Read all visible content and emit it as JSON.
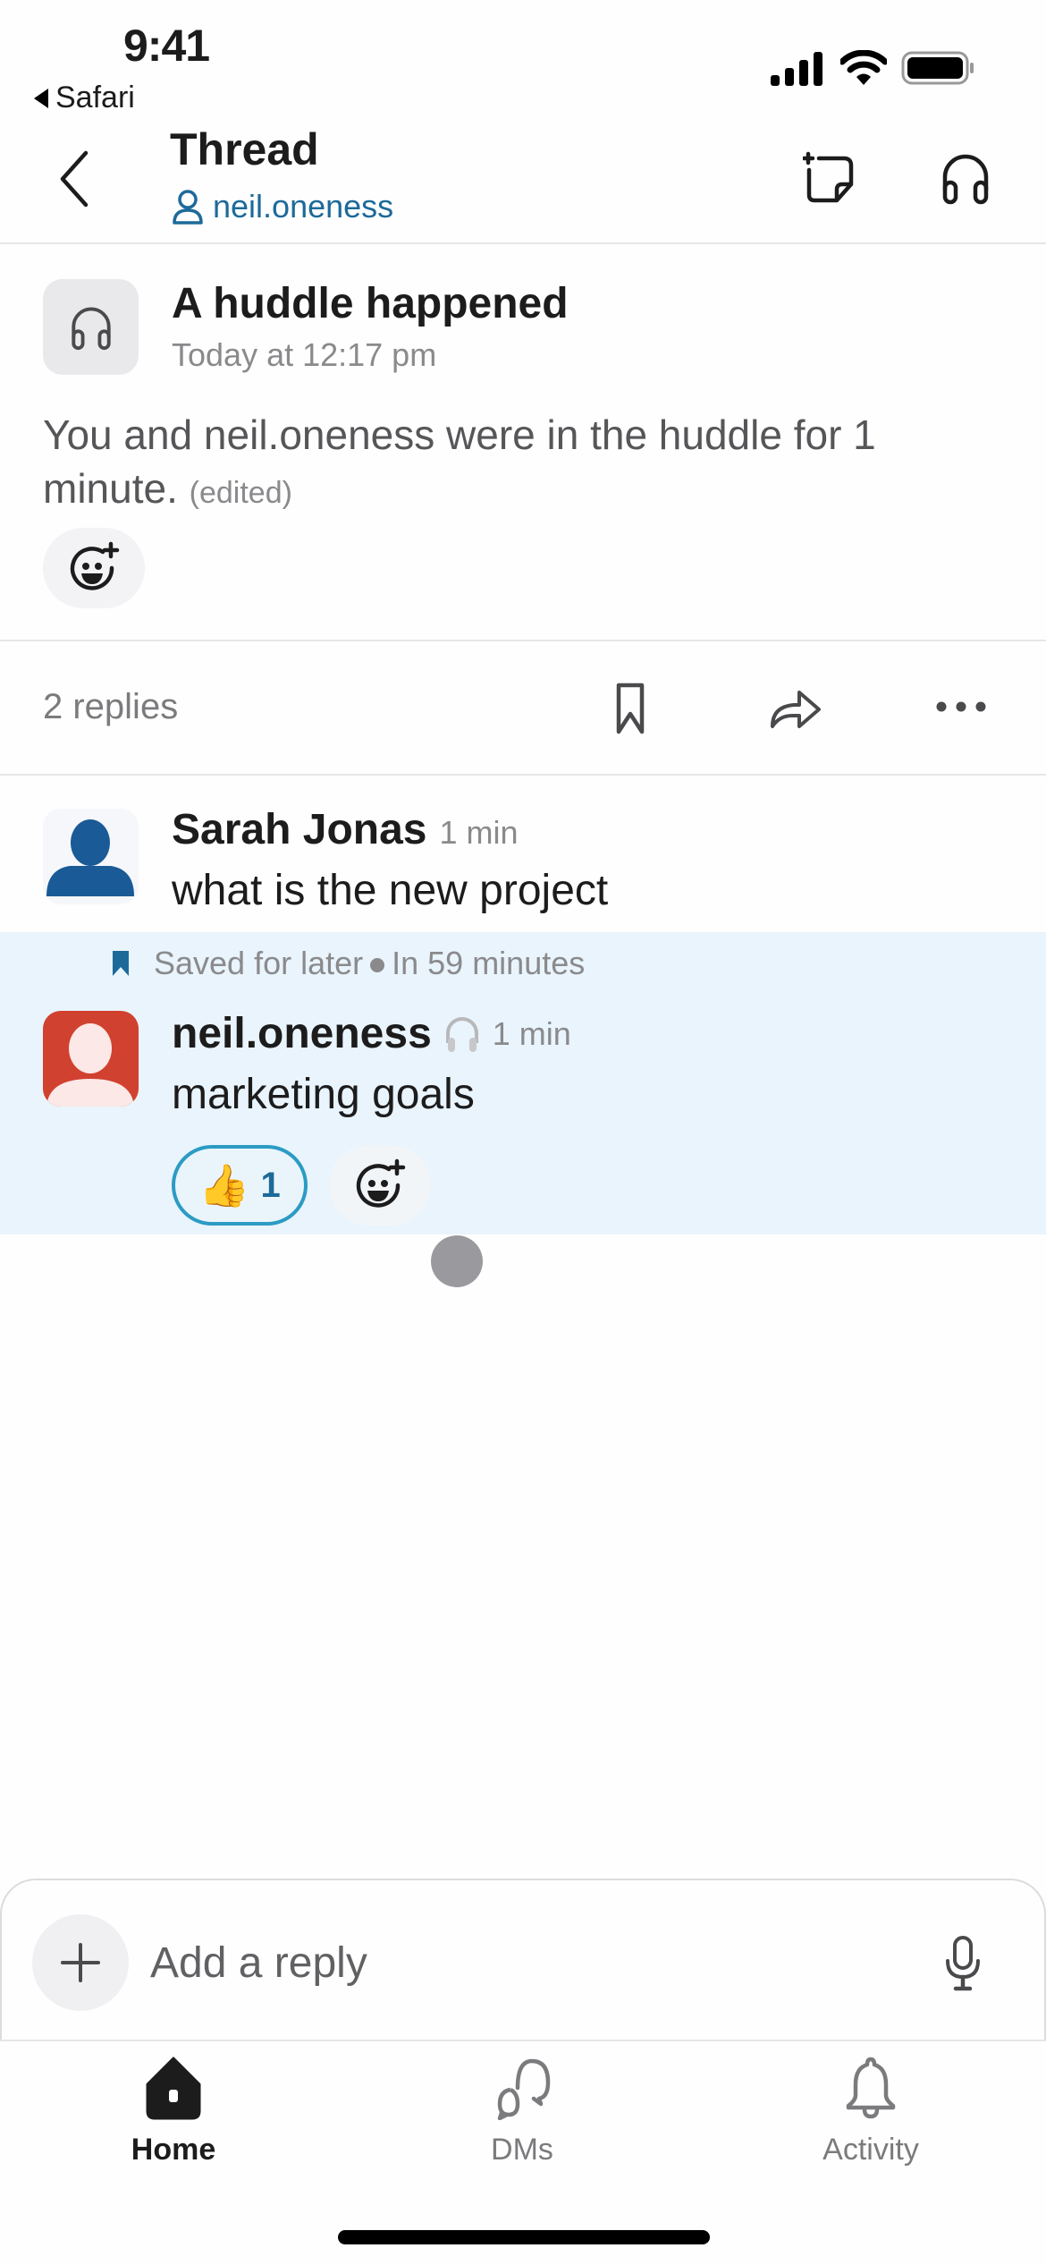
{
  "status_bar": {
    "time": "9:41",
    "back_app": "Safari"
  },
  "header": {
    "title": "Thread",
    "subtitle_user": "neil.oneness"
  },
  "huddle": {
    "title": "A huddle happened",
    "timestamp": "Today at 12:17 pm",
    "body": "You and neil.oneness were in the huddle for 1 minute.",
    "edited_label": "(edited)"
  },
  "replies_bar": {
    "count_label": "2 replies"
  },
  "messages": [
    {
      "author": "Sarah Jonas",
      "time": "1 min",
      "text": "what is the new project",
      "avatar_color": "#1a5a96"
    },
    {
      "saved_label": "Saved for later",
      "saved_due": "In 59 minutes",
      "author": "neil.oneness",
      "status_icon": "headphones",
      "time": "1 min",
      "text": "marketing goals",
      "avatar_color": "#d1412f",
      "reactions": [
        {
          "emoji": "👍",
          "count": "1"
        }
      ]
    }
  ],
  "composer": {
    "placeholder": "Add a reply"
  },
  "tabs": [
    {
      "label": "Home",
      "icon": "home-icon",
      "active": true
    },
    {
      "label": "DMs",
      "icon": "dms-icon",
      "active": false
    },
    {
      "label": "Activity",
      "icon": "bell-icon",
      "active": false
    }
  ],
  "colors": {
    "accent": "#1d6a99",
    "highlight_bg": "#e9f4fc",
    "reaction_border": "#2b9bc4"
  }
}
